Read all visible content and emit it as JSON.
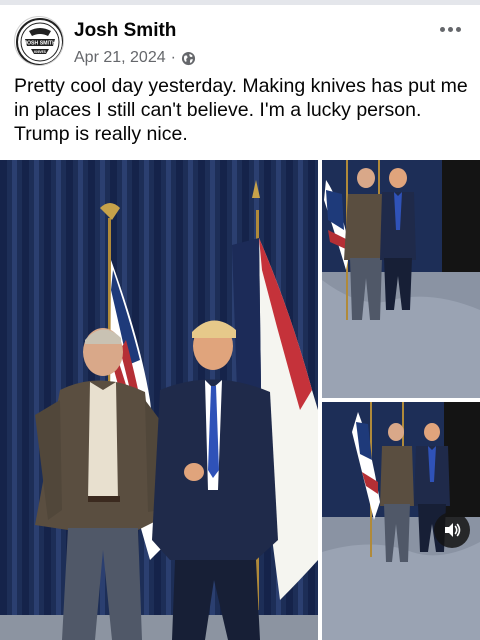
{
  "post": {
    "author": "Josh Smith",
    "date": "Apr 21, 2024",
    "separator": "·",
    "privacy_icon": "globe-icon",
    "more_icon": "more-options-icon",
    "text": "Pretty cool day yesterday.  Making knives has put me in places I still can't believe.  I'm a lucky person.  Trump is really nice.",
    "avatar": {
      "logo_text": "JOSH SMITH",
      "logo_subtext": "KNIVES"
    }
  },
  "photos": {
    "count": 3,
    "sound_icon": "sound-on-icon"
  },
  "colors": {
    "secondary_text": "#65676b",
    "primary_text": "#050505",
    "curtain": "#1e2f55"
  }
}
